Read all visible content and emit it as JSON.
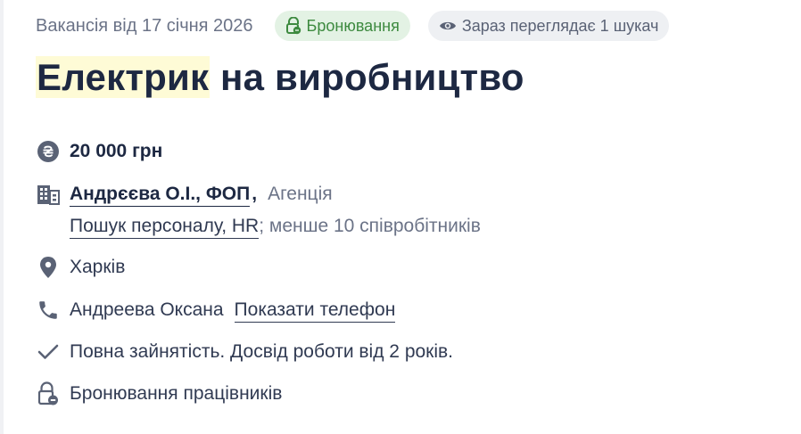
{
  "header": {
    "posted_text": "Вакансія від 17 січня 2026",
    "booking_badge": "Бронювання",
    "viewers_badge": "Зараз переглядає 1 шукач"
  },
  "title": {
    "highlighted": "Електрик",
    "rest": " на виробництво"
  },
  "details": {
    "salary": "20 000 грн",
    "company_name": "Андрєєва О.І., ФОП",
    "company_separator": ",",
    "company_type": "Агенція",
    "company_sector": "Пошук персоналу, HR",
    "company_size": "; менше 10 співробітників",
    "city": "Харків",
    "contact_name": "Андреева Оксана",
    "show_phone_link": "Показати телефон",
    "employment": "Повна зайнятість. Досвід роботи від 2 років.",
    "booking_line": "Бронювання працівників"
  },
  "icons": {
    "salary": "hryvnia-icon",
    "company": "building-icon",
    "city": "location-pin-icon",
    "phone": "phone-icon",
    "employment": "checkmark-icon",
    "booking": "lock-badge-icon",
    "header_booking": "lock-badge-icon",
    "header_viewers": "eye-icon"
  },
  "colors": {
    "title": "#1d2842",
    "text": "#303a52",
    "muted": "#6b7387",
    "badge_green_bg": "#e3f2e4",
    "badge_green_fg": "#3d8a3f",
    "badge_grey_bg": "#eef0f3",
    "title_highlight": "#fefbd6"
  }
}
